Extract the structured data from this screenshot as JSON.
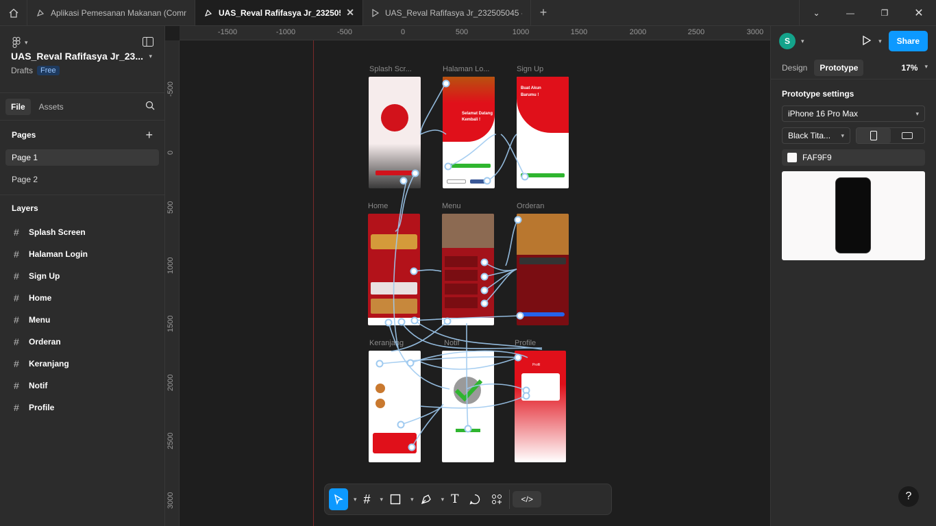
{
  "tabs": [
    {
      "label": "Aplikasi Pemesanan Makanan (Comm",
      "icon": "figma-file-icon"
    },
    {
      "label": "UAS_Reval Rafifasya Jr_2325050",
      "icon": "figma-file-icon"
    },
    {
      "label": "UAS_Reval Rafifasya Jr_232505045 -",
      "icon": "play-icon"
    }
  ],
  "file": {
    "title": "UAS_Reval Rafifasya Jr_23...",
    "location": "Drafts",
    "plan_badge": "Free",
    "tab_file": "File",
    "tab_assets": "Assets"
  },
  "pages": {
    "heading": "Pages",
    "items": [
      "Page 1",
      "Page 2"
    ]
  },
  "layers": {
    "heading": "Layers",
    "items": [
      "Splash Screen",
      "Halaman Login",
      "Sign Up",
      "Home",
      "Menu",
      "Orderan",
      "Keranjang",
      "Notif",
      "Profile"
    ]
  },
  "right_panel": {
    "avatar_letter": "S",
    "share_label": "Share",
    "tab_design": "Design",
    "tab_prototype": "Prototype",
    "zoom": "17%",
    "settings_title": "Prototype settings",
    "device": "iPhone 16 Pro Max",
    "device_color": "Black Tita...",
    "background_hex": "FAF9F9",
    "help": "?"
  },
  "ruler": {
    "x_ticks": [
      "-1500",
      "-1000",
      "-500",
      "0",
      "500",
      "1000",
      "1500",
      "2000",
      "2500",
      "3000"
    ],
    "y_ticks": [
      "-500",
      "0",
      "500",
      "1000",
      "1500",
      "2000",
      "2500",
      "3000"
    ]
  },
  "frames": {
    "labels": [
      "Splash Scr...",
      "Halaman Lo...",
      "Sign Up",
      "Home",
      "Menu",
      "Orderan",
      "Keranjang",
      "Notif",
      "Profile"
    ],
    "login_welcome": "Selamat Datang Kembali !",
    "signup_title": "Buat Akun Barumu !",
    "profile_title": "Profil"
  },
  "colors": {
    "accent": "#0d99ff",
    "brand_red": "#e0101a",
    "canvas_bg": "#1e1e1e",
    "panel_bg": "#2c2c2c"
  }
}
